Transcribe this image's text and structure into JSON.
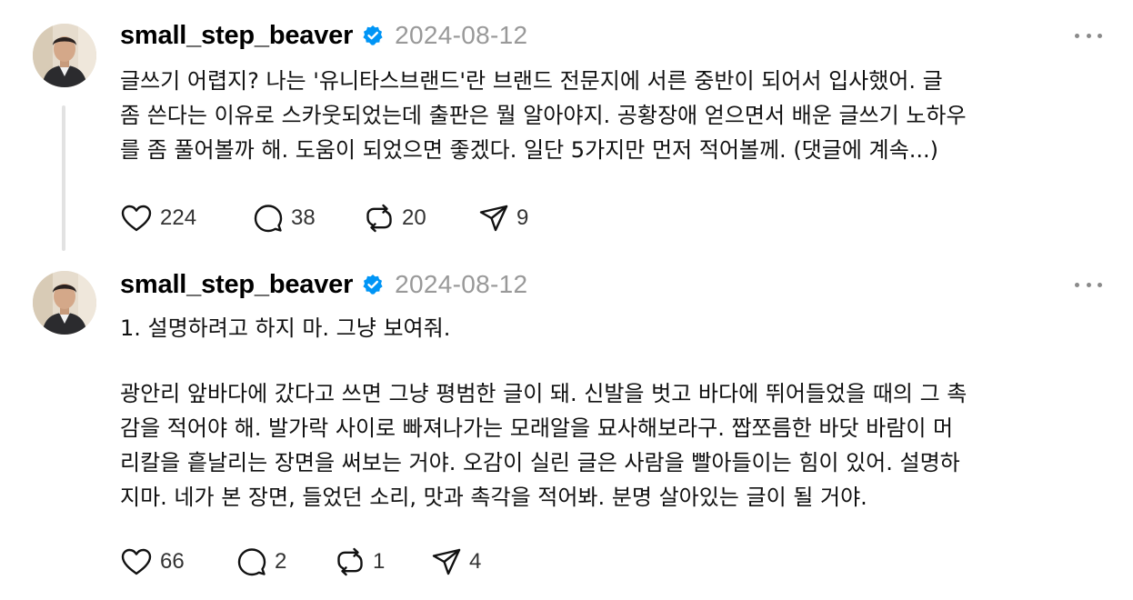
{
  "posts": [
    {
      "username": "small_step_beaver",
      "date": "2024-08-12",
      "lines": [
        "글쓰기 어렵지? 나는 '유니타스브랜드'란 브랜드 전문지에 서른 중반이 되어서 입사했어. 글",
        "좀 쓴다는 이유로 스카웃되었는데 출판은 뭘 알아야지. 공황장애 얻으면서 배운 글쓰기 노하우",
        "를 좀 풀어볼까 해. 도움이 되었으면 좋겠다. 일단 5가지만 먼저 적어볼께. (댓글에 계속...)"
      ],
      "likes": "224",
      "comments": "38",
      "reposts": "20",
      "shares": "9"
    },
    {
      "username": "small_step_beaver",
      "date": "2024-08-12",
      "heading": "1. 설명하려고 하지 마. 그냥 보여줘.",
      "lines": [
        "광안리 앞바다에 갔다고 쓰면 그냥 평범한 글이 돼. 신발을 벗고 바다에 뛰어들었을 때의 그 촉",
        "감을 적어야 해. 발가락 사이로 빠져나가는 모래알을 묘사해보라구. 짭쪼름한 바닷 바람이 머",
        "리칼을 흩날리는 장면을 써보는 거야. 오감이 실린 글은 사람을 빨아들이는 힘이 있어. 설명하",
        "지마. 네가 본 장면, 들었던 소리, 맛과 촉각을 적어봐. 분명 살아있는 글이 될 거야."
      ],
      "likes": "66",
      "comments": "2",
      "reposts": "1",
      "shares": "4"
    }
  ],
  "icons": {
    "avatar": "avatar-photo",
    "verified": "verified-badge-icon",
    "more": "more-options-icon",
    "like": "heart-icon",
    "comment": "comment-bubble-icon",
    "repost": "repost-icon",
    "share": "send-icon"
  },
  "colors": {
    "verified": "#0095f6",
    "date": "#999999",
    "icon": "#111111",
    "thread_line": "#e2e2e2"
  }
}
